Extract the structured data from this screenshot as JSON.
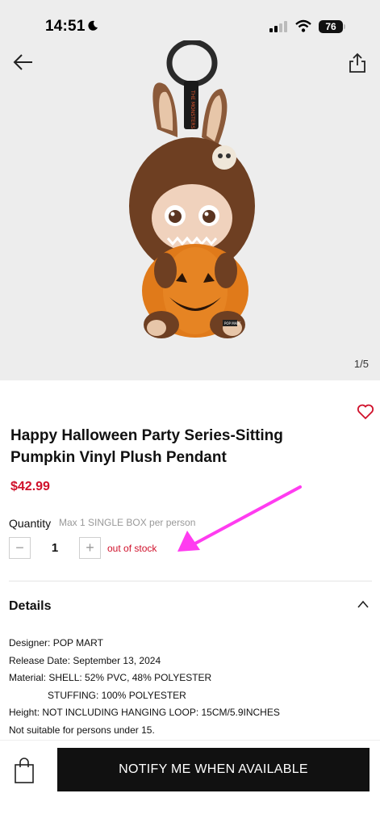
{
  "status": {
    "time": "14:51",
    "battery": "76"
  },
  "gallery": {
    "counter": "1/5"
  },
  "product": {
    "title_line1": "Happy Halloween Party Series-Sitting",
    "title_line2": "Pumpkin Vinyl Plush Pendant",
    "price": "$42.99",
    "strap_text": "THE MONSTERS",
    "tag_text": "POP MART"
  },
  "quantity": {
    "label": "Quantity",
    "note": "Max 1 SINGLE BOX per person",
    "minus": "−",
    "value": "1",
    "plus": "+",
    "stock_status": "out of stock"
  },
  "details": {
    "heading": "Details",
    "lines": [
      "Designer: POP MART",
      "Release Date: September 13, 2024",
      "Material: SHELL: 52% PVC, 48% POLYESTER",
      "STUFFING: 100% POLYESTER",
      "Height: NOT INCLUDING HANGING LOOP: 15CM/5.9INCHES",
      "Not suitable for persons under 15."
    ]
  },
  "actions": {
    "notify": "NOTIFY ME WHEN AVAILABLE"
  },
  "colors": {
    "accent": "#d0112b",
    "annotation_arrow": "#ff3cf0",
    "button_bg": "#111111"
  },
  "icons": [
    "back-arrow-icon",
    "share-icon",
    "heart-icon",
    "chevron-up-icon",
    "shopping-bag-icon",
    "moon-icon",
    "signal-icon",
    "wifi-icon",
    "battery-icon"
  ]
}
